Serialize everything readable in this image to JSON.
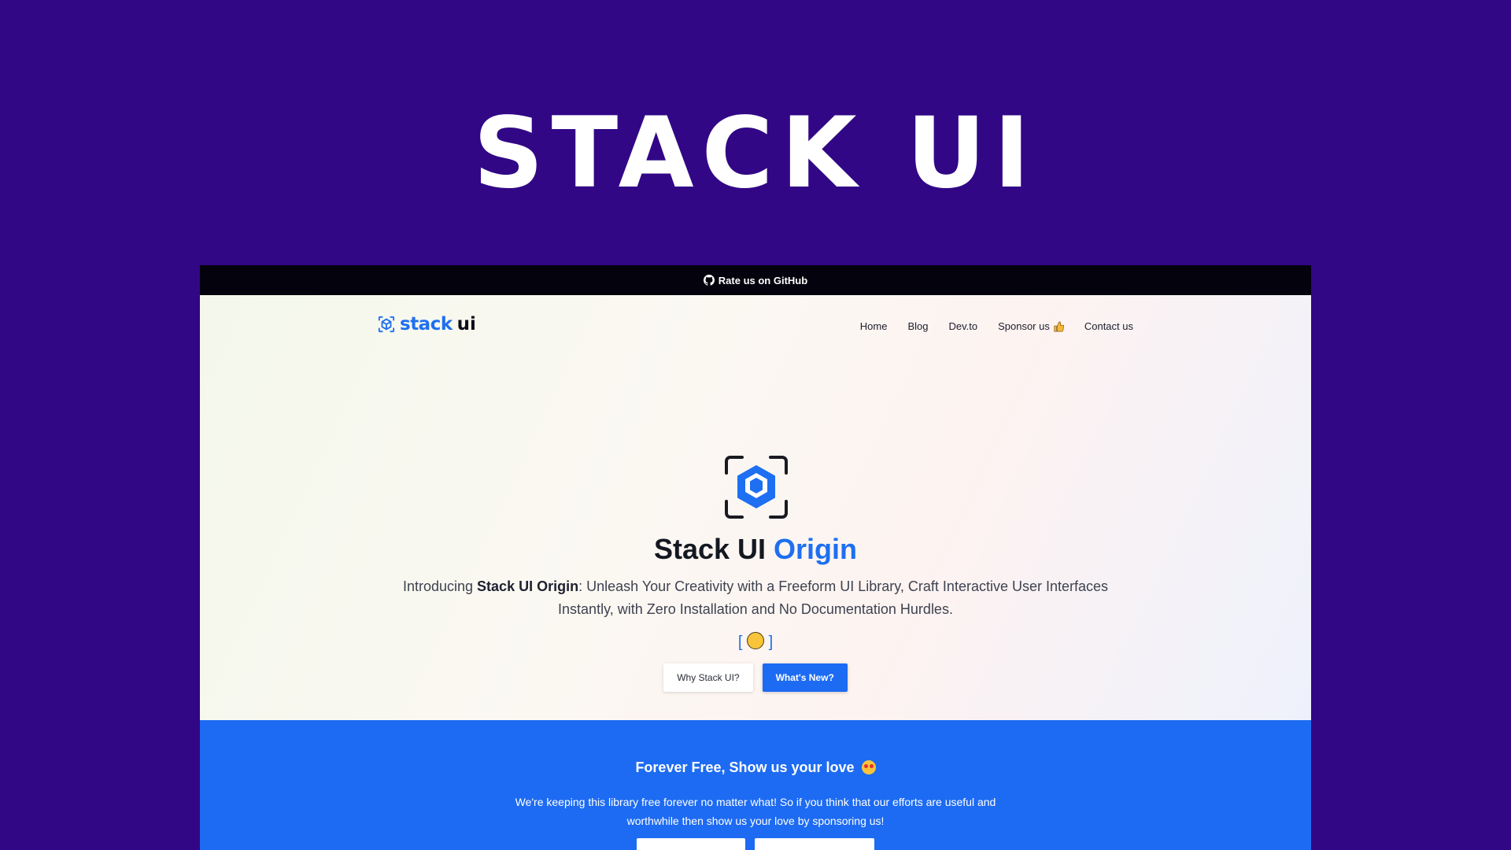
{
  "banner": {
    "title": "STACK UI"
  },
  "topbar": {
    "github_label": "Rate us on GitHub",
    "icon": "github-icon"
  },
  "nav": {
    "logo_stack": "stack",
    "logo_ui": "ui",
    "items": [
      {
        "label": "Home"
      },
      {
        "label": "Blog"
      },
      {
        "label": "Dev.to"
      },
      {
        "label": "Sponsor us",
        "icon": "thumbs-up-icon"
      },
      {
        "label": "Contact us"
      }
    ]
  },
  "hero": {
    "title_main": "Stack UI",
    "title_accent": "Origin",
    "desc_intro": "Introducing ",
    "desc_bold": "Stack UI Origin",
    "desc_rest": ": Unleash Your Creativity with a Freeform UI Library, Craft Interactive User Interfaces Instantly, with Zero Installation and No Documentation Hurdles.",
    "bracket_open": "[",
    "bracket_close": "]",
    "buttons": {
      "why": "Why Stack UI?",
      "whats_new": "What's New?"
    }
  },
  "sponsor": {
    "title": "Forever Free, Show us your love",
    "text": "We're keeping this library free forever no matter what! So if you think that our efforts are useful and worthwhile then show us your love by sponsoring us!"
  },
  "colors": {
    "background": "#310786",
    "accent": "#1e6ff1",
    "topbar": "#03020d"
  }
}
